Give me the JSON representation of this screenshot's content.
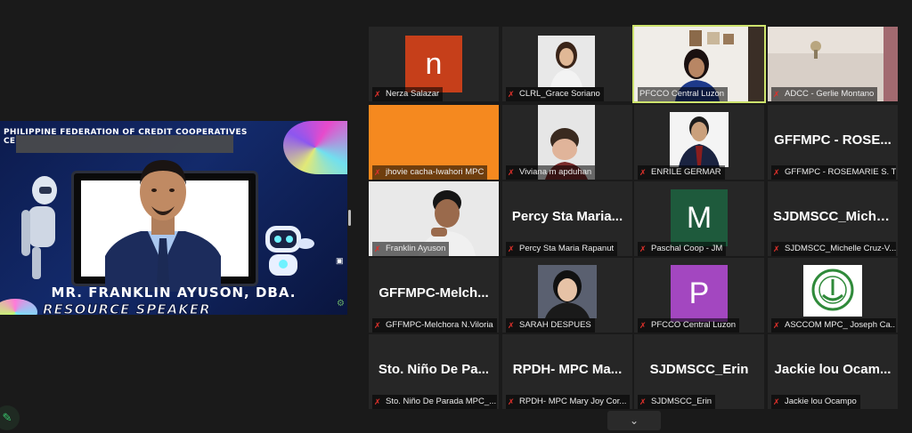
{
  "shared_screen": {
    "banner_text": "PHILIPPINE FEDERATION OF CREDIT COOPERATIVES",
    "banner_code": "CE",
    "speaker_name": "MR. FRANKLIN AYUSON, DBA.",
    "speaker_role": "RESOURCE SPEAKER"
  },
  "tiles": [
    {
      "label": "Nerza Salazar",
      "type": "avatar",
      "letter": "n",
      "color": "#c63f1a"
    },
    {
      "label": "CLRL_Grace Soriano",
      "type": "photo"
    },
    {
      "label": "PFCCO Central Luzon",
      "type": "photo",
      "active": true
    },
    {
      "label": "ADCC - Gerlie Montano",
      "type": "photo"
    },
    {
      "label": "jhovie cacha-Iwahori MPC",
      "type": "color",
      "color": "#f5891f"
    },
    {
      "label": "Viviana m apduhan",
      "type": "photo"
    },
    {
      "label": "ENRILE GERMAR",
      "type": "photo"
    },
    {
      "label": "GFFMPC - ROSEMARIE S. T...",
      "type": "name",
      "name": "GFFMPC - ROSE..."
    },
    {
      "label": "Franklin Ayuson",
      "type": "photo"
    },
    {
      "label": "Percy Sta Maria Rapanut",
      "type": "name",
      "name": "Percy Sta Maria..."
    },
    {
      "label": "Paschal Coop - JM",
      "type": "avatar",
      "letter": "M",
      "color": "#1e5a3c"
    },
    {
      "label": "SJDMSCC_Michelle Cruz-V...",
      "type": "name",
      "name": "SJDMSCC_Miche..."
    },
    {
      "label": "GFFMPC-Melchora N.Viloria",
      "type": "name",
      "name": "GFFMPC-Melch..."
    },
    {
      "label": "SARAH DESPUES",
      "type": "photo"
    },
    {
      "label": "PFCCO Central Luzon",
      "type": "avatar",
      "letter": "P",
      "color": "#a347c0"
    },
    {
      "label": "ASCCOM MPC_ Joseph Ca...",
      "type": "photo"
    },
    {
      "label": "Sto. Niño De Parada MPC_...",
      "type": "name",
      "name": "Sto. Niño De Pa..."
    },
    {
      "label": "RPDH- MPC Mary Joy Cor...",
      "type": "name",
      "name": "RPDH- MPC Ma..."
    },
    {
      "label": "SJDMSCC_Erin",
      "type": "name",
      "name": "SJDMSCC_Erin"
    },
    {
      "label": "Jackie lou Ocampo",
      "type": "name",
      "name": "Jackie lou Ocam..."
    }
  ]
}
